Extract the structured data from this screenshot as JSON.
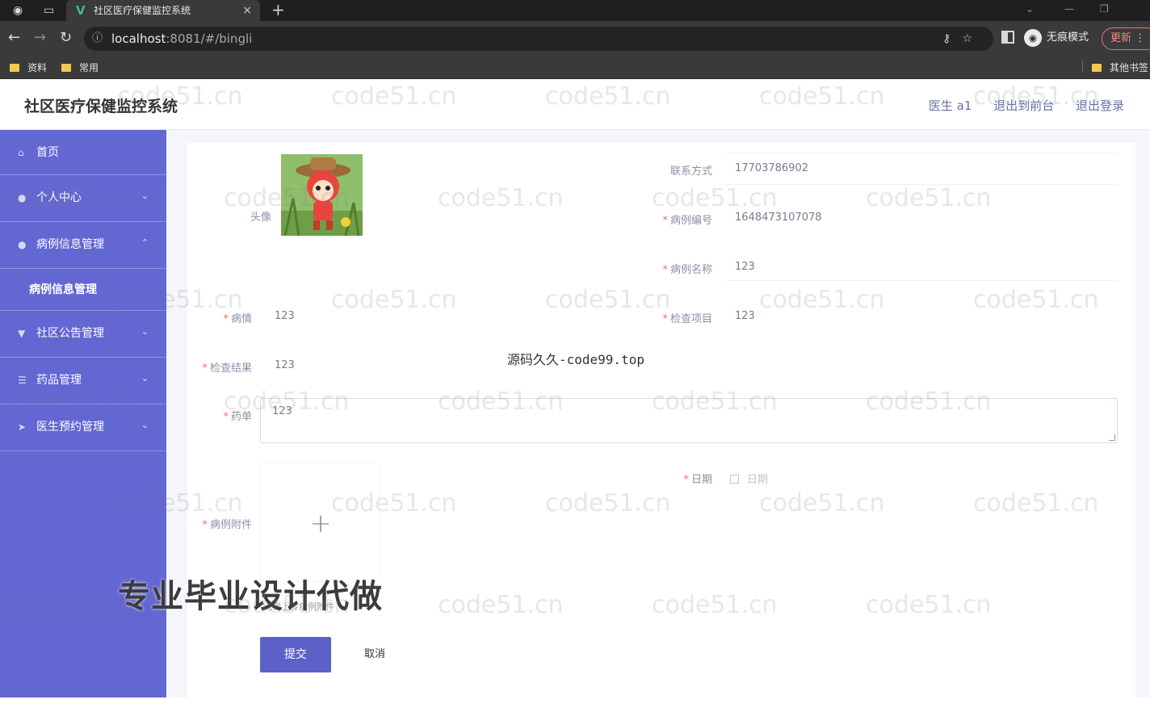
{
  "browser": {
    "tab_title": "社区医疗保健监控系统",
    "tab_close": "×",
    "new_tab": "+",
    "url_host": "localhost",
    "url_rest": ":8081/#/bingli",
    "incognito_label": "无痕模式",
    "update_label": "更新",
    "bookmarks": [
      "资料",
      "常用"
    ],
    "other_bookmarks": "其他书签"
  },
  "header": {
    "title": "社区医疗保健监控系统",
    "user": "医生 a1",
    "to_front": "退出到前台",
    "logout": "退出登录"
  },
  "sidebar": {
    "items": [
      {
        "label": "首页",
        "arrow": ""
      },
      {
        "label": "个人中心",
        "arrow": "⌄"
      },
      {
        "label": "病例信息管理",
        "arrow": "⌃"
      },
      {
        "label": "社区公告管理",
        "arrow": "⌄"
      },
      {
        "label": "药品管理",
        "arrow": "⌄"
      },
      {
        "label": "医生预约管理",
        "arrow": "⌄"
      }
    ],
    "submenu_label": "病例信息管理"
  },
  "form": {
    "avatar_label": "头像",
    "contact_label": "联系方式",
    "contact_value": "17703786902",
    "case_no_label": "病例编号",
    "case_no_value": "1648473107078",
    "case_name_label": "病例名称",
    "case_name_value": "123",
    "condition_label": "病情",
    "condition_value": "123",
    "exam_item_label": "检查项目",
    "exam_item_value": "123",
    "exam_result_label": "检查结果",
    "exam_result_value": "123",
    "prescription_label": "药单",
    "prescription_value": "123",
    "date_label": "日期",
    "date_placeholder": "日期",
    "attachment_label": "病例附件",
    "upload_tip": "点击上传病例附件",
    "submit": "提交",
    "cancel": "取消"
  },
  "overlays": {
    "center_watermark": "源码久久-code99.top",
    "promo": "专业毕业设计代做",
    "tiled_watermark": "code51.cn"
  }
}
